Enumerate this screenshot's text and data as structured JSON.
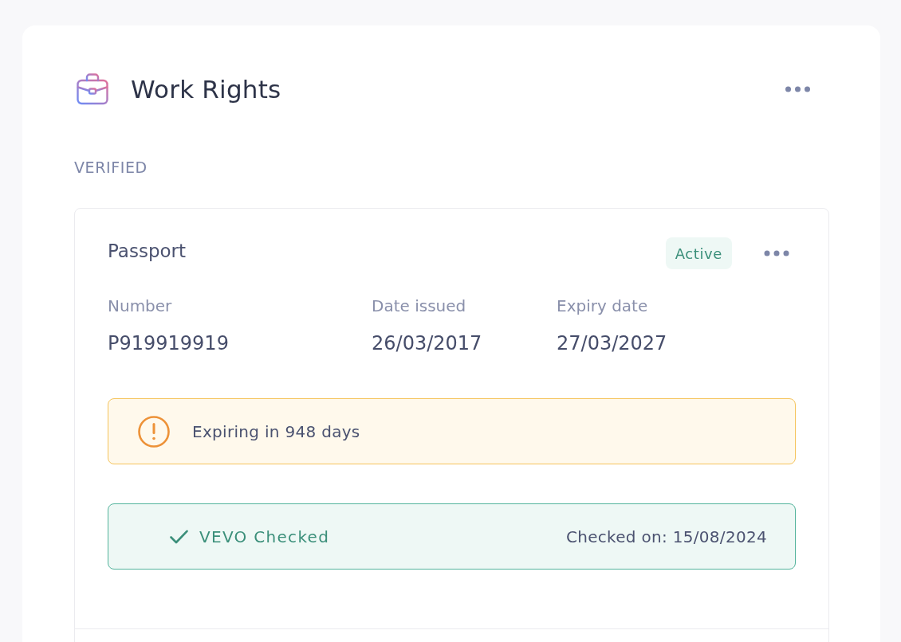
{
  "card": {
    "title": "Work Rights",
    "section_label": "VERIFIED",
    "documents": [
      {
        "title": "Passport",
        "status": {
          "label": "Active",
          "kind": "active"
        },
        "fields": [
          {
            "label": "Number",
            "value": "P919919919"
          },
          {
            "label": "Date issued",
            "value": "26/03/2017"
          },
          {
            "label": "Expiry date",
            "value": "27/03/2027"
          }
        ],
        "notices": [
          {
            "kind": "warning",
            "text": "Expiring in 948 days"
          },
          {
            "kind": "success",
            "text": "VEVO Checked",
            "detail": "Checked on: 15/08/2024"
          }
        ]
      }
    ]
  }
}
